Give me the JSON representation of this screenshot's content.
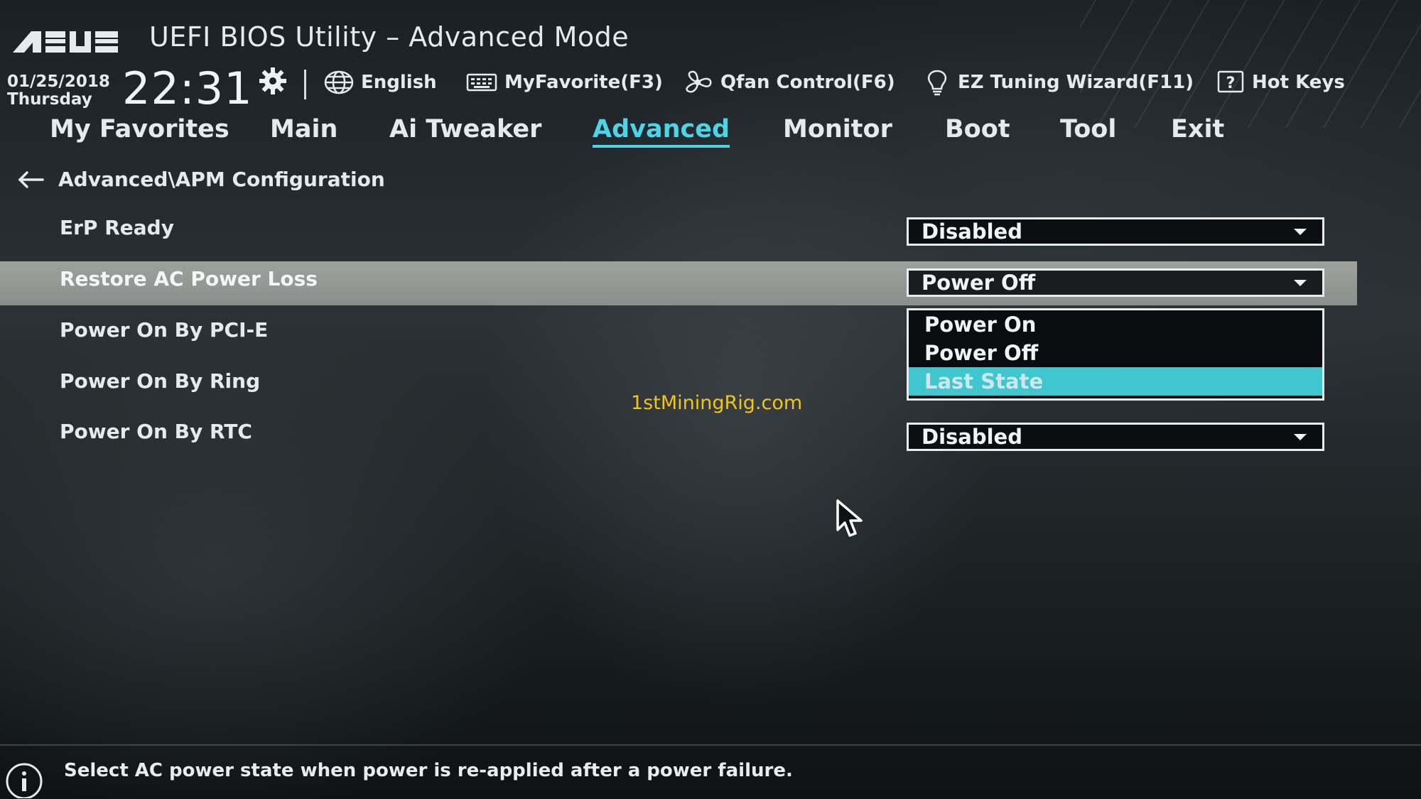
{
  "header": {
    "brand": "ASUS",
    "title": "UEFI BIOS Utility – Advanced Mode",
    "date": "01/25/2018",
    "day": "Thursday",
    "time": "22:31",
    "toolbar": {
      "language": "English",
      "favorite": "MyFavorite(F3)",
      "qfan": "Qfan Control(F6)",
      "ez_tuning": "EZ Tuning Wizard(F11)",
      "hotkeys": "Hot Keys"
    }
  },
  "nav": {
    "items": [
      "My Favorites",
      "Main",
      "Ai Tweaker",
      "Advanced",
      "Monitor",
      "Boot",
      "Tool",
      "Exit"
    ],
    "active": "Advanced"
  },
  "breadcrumb": "Advanced\\APM Configuration",
  "settings": [
    {
      "label": "ErP Ready",
      "value": "Disabled"
    },
    {
      "label": "Restore AC Power Loss",
      "value": "Power Off"
    },
    {
      "label": "Power On By PCI-E"
    },
    {
      "label": "Power On By Ring"
    },
    {
      "label": "Power On By RTC",
      "value": "Disabled"
    }
  ],
  "dropdown": {
    "options": [
      "Power On",
      "Power Off",
      "Last State"
    ],
    "highlighted": "Last State"
  },
  "watermark": "1stMiningRig.com",
  "help_text": "Select AC power state when power is re-applied after a power failure.",
  "colors": {
    "accent": "#4fd3e6",
    "highlight_option": "#3fc6cf",
    "selected_row": "#9ea19e",
    "watermark": "#f2c318"
  }
}
